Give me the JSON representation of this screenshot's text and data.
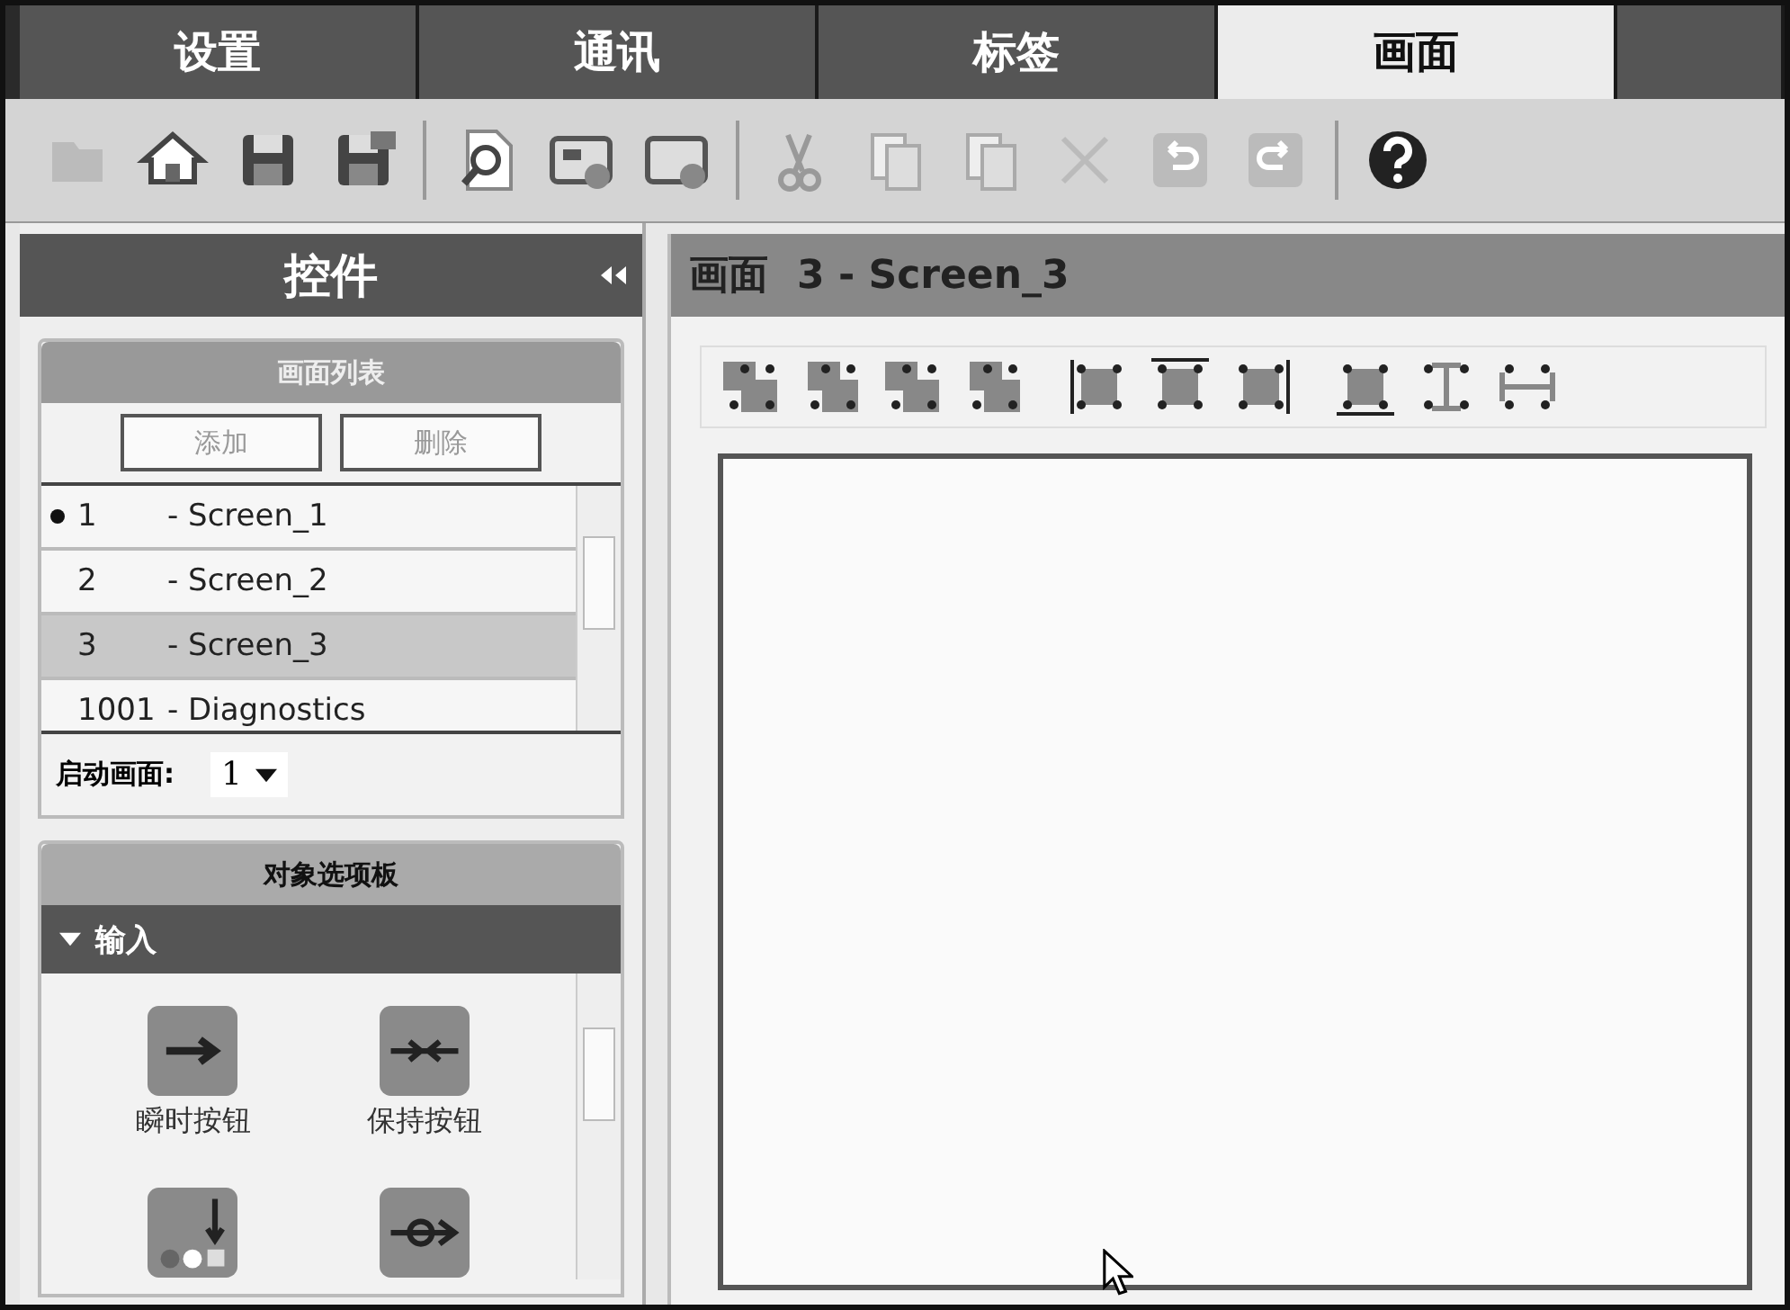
{
  "tabs": [
    {
      "label": "设置",
      "selected": false
    },
    {
      "label": "通讯",
      "selected": false
    },
    {
      "label": "标签",
      "selected": false
    },
    {
      "label": "画面",
      "selected": true
    }
  ],
  "panel": {
    "title": "控件"
  },
  "screen_list": {
    "title": "画面列表",
    "buttons": [
      "添加",
      "删除"
    ],
    "items": [
      {
        "number": "1",
        "name": "- Screen_1",
        "startup": true,
        "selected": false
      },
      {
        "number": "2",
        "name": "- Screen_2",
        "startup": false,
        "selected": false
      },
      {
        "number": "3",
        "name": "- Screen_3",
        "startup": false,
        "selected": true
      },
      {
        "number": "1001",
        "name": "- Diagnostics",
        "startup": false,
        "selected": false
      }
    ],
    "startup_label": "启动画面:",
    "startup_value": "1"
  },
  "palette": {
    "title": "对象选项板",
    "section": "输入",
    "expanded": true,
    "items": [
      "瞬时按钮",
      "保持按钮"
    ]
  },
  "editor": {
    "label": "画面",
    "screen": "3 - Screen_3"
  }
}
